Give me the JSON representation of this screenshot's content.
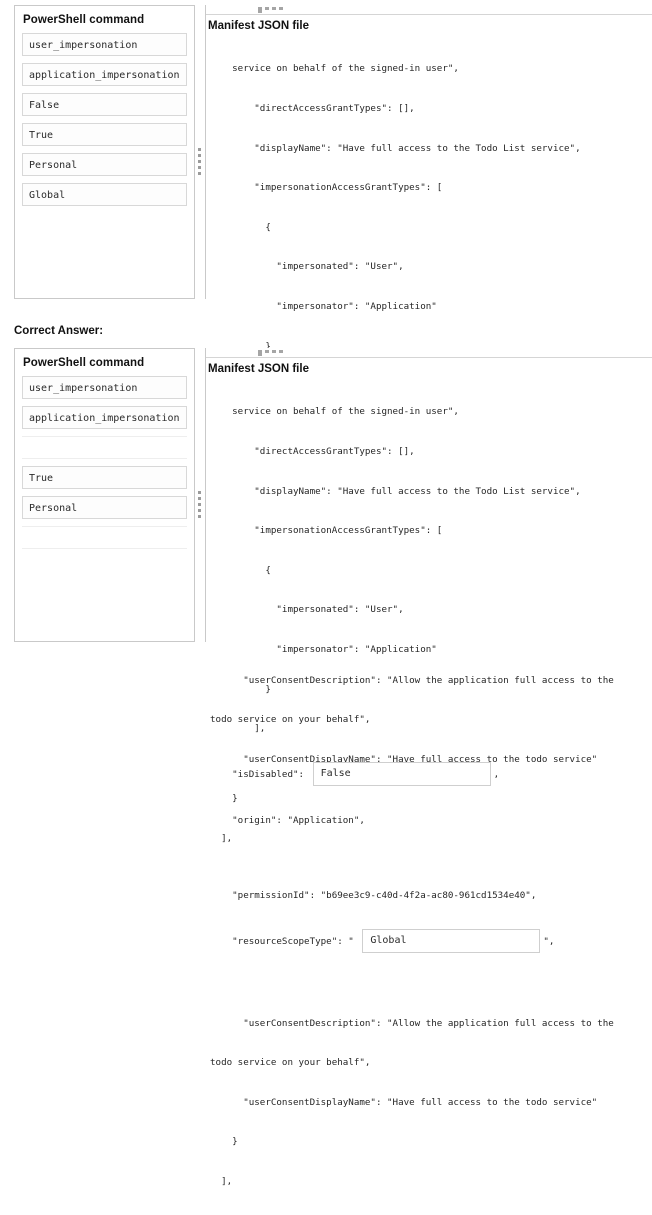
{
  "answer_caption": "Correct Answer:",
  "pool": {
    "header": "PowerShell command",
    "question_items": [
      "user_impersonation",
      "application_impersonation",
      "False",
      "True",
      "Personal",
      "Global"
    ],
    "answer_items": [
      "user_impersonation",
      "application_impersonation",
      "",
      "True",
      "Personal",
      ""
    ]
  },
  "manifest": {
    "header": "Manifest JSON file",
    "lines": {
      "l1": "    service on behalf of the signed-in user\",",
      "l2": "        \"directAccessGrantTypes\": [],",
      "l3": "        \"displayName\": \"Have full access to the Todo List service\",",
      "l4": "        \"impersonationAccessGrantTypes\": [",
      "l5": "          {",
      "l6": "            \"impersonated\": \"User\",",
      "l7": "            \"impersonator\": \"Application\"",
      "l8": "          }",
      "l9": "        ],",
      "l10_pre": "    \"isDisabled\": ",
      "l10_post": ",",
      "l11": "    \"origin\": \"Application\",",
      "l12": "    \"permissionId\": \"b69ee3c9-c40d-4f2a-ac80-961cd1534e40\",",
      "l13_pre": "    \"resourceScopeType\": \" ",
      "l13_post": "\",",
      "l14": "      \"userConsentDescription\": \"Allow the application full access to the",
      "l15": "todo service on your behalf\",",
      "l16": "      \"userConsentDisplayName\": \"Have full access to the todo service\"",
      "l17": "    }",
      "l18": "  ],"
    },
    "slot_placeholder": "PowerShell command",
    "question_slots": {
      "is_disabled": "PowerShell command",
      "resource_scope_type": "PowerShell command"
    },
    "answer_slots": {
      "is_disabled": "False",
      "resource_scope_type": "Global"
    }
  }
}
